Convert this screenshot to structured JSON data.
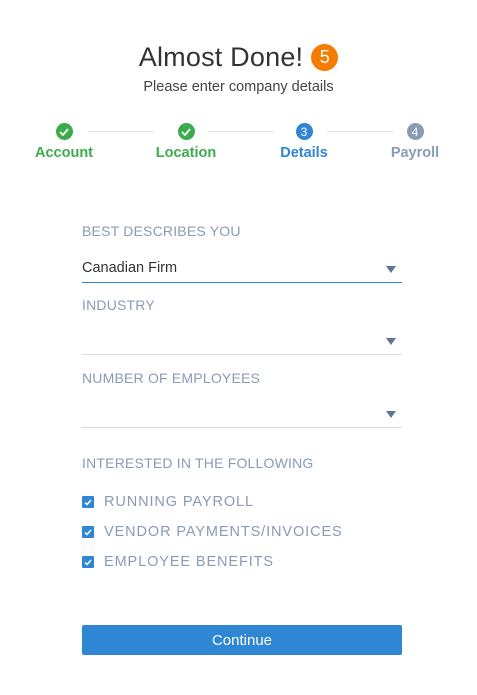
{
  "header": {
    "title": "Almost Done!",
    "step_badge": "5",
    "subtitle": "Please enter company details"
  },
  "stepper": {
    "steps": [
      {
        "label": "Account",
        "status": "done",
        "number": "1"
      },
      {
        "label": "Location",
        "status": "done",
        "number": "2"
      },
      {
        "label": "Details",
        "status": "active",
        "number": "3"
      },
      {
        "label": "Payroll",
        "status": "pending",
        "number": "4"
      }
    ]
  },
  "form": {
    "describes_you": {
      "label": "BEST DESCRIBES YOU",
      "value": "Canadian Firm"
    },
    "industry": {
      "label": "INDUSTRY",
      "value": ""
    },
    "employees": {
      "label": "NUMBER OF EMPLOYEES",
      "value": ""
    },
    "interests": {
      "label": "INTERESTED IN THE FOLLOWING",
      "options": [
        {
          "label": "RUNNING PAYROLL",
          "checked": true
        },
        {
          "label": "VENDOR PAYMENTS/INVOICES",
          "checked": true
        },
        {
          "label": "EMPLOYEE BENEFITS",
          "checked": true
        }
      ]
    }
  },
  "actions": {
    "continue_label": "Continue"
  },
  "colors": {
    "success": "#3bab4c",
    "primary": "#2f86d3",
    "muted": "#8a9bb4",
    "badge": "#f57c00"
  }
}
